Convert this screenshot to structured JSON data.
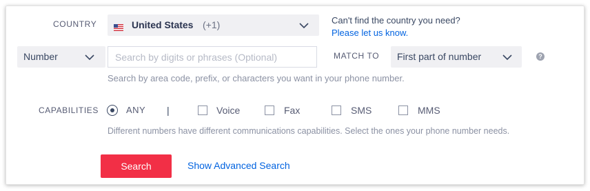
{
  "country": {
    "label": "COUNTRY",
    "selected_name": "United States",
    "selected_code": "(+1)",
    "flag_icon": "us-flag-icon",
    "help_text": "Can't find the country you need?",
    "help_link": "Please let us know."
  },
  "number": {
    "type_selected": "Number",
    "search_placeholder": "Search by digits or phrases (Optional)",
    "match_to_label": "MATCH TO",
    "match_to_selected": "First part of number",
    "help_icon": "question-icon",
    "hint": "Search by area code, prefix, or characters you want in your phone number."
  },
  "capabilities": {
    "label": "CAPABILITIES",
    "any_label": "ANY",
    "any_selected": true,
    "separator": "|",
    "options": [
      {
        "label": "Voice",
        "checked": false
      },
      {
        "label": "Fax",
        "checked": false
      },
      {
        "label": "SMS",
        "checked": false
      },
      {
        "label": "MMS",
        "checked": false
      }
    ],
    "hint": "Different numbers have different communications capabilities. Select the ones your phone number needs."
  },
  "actions": {
    "search_label": "Search",
    "advanced_link": "Show Advanced Search"
  },
  "colors": {
    "accent": "#f22f46",
    "link": "#0263e0",
    "text": "#394762",
    "muted": "#8b91a3"
  }
}
